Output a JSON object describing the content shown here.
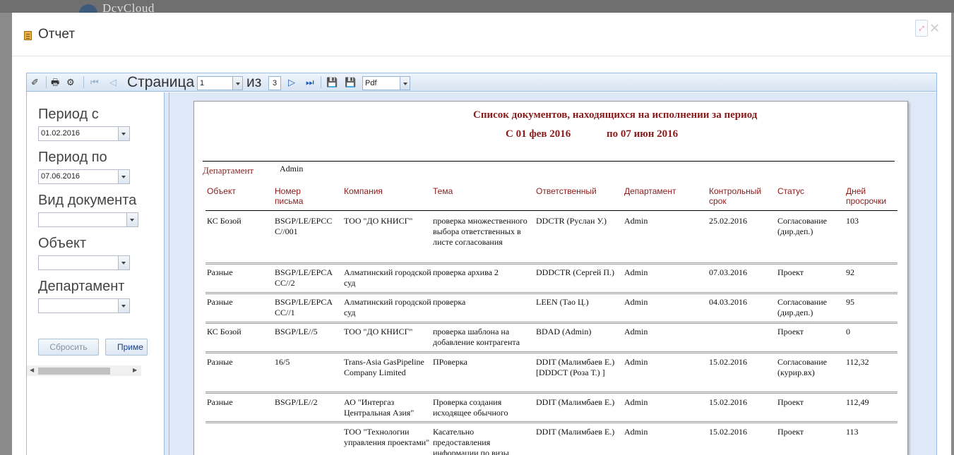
{
  "background": {
    "brand": "DcvCloud"
  },
  "modal": {
    "title": "Отчет"
  },
  "toolbar": {
    "page_label": "Страница",
    "page_value": "1",
    "of_label": "из",
    "total_pages": "3",
    "format_value": "Pdf"
  },
  "params": {
    "period_from_label": "Период с",
    "period_from_value": "01.02.2016",
    "period_to_label": "Период по",
    "period_to_value": "07.06.2016",
    "doc_type_label": "Вид документа",
    "doc_type_value": "",
    "object_label": "Объект",
    "object_value": "",
    "department_label": "Департамент",
    "department_value": "",
    "reset_label": "Сбросить",
    "apply_label": "Приме"
  },
  "report": {
    "title": "Список документов, находящихся на исполнении за период",
    "period_from": "С 01 фев 2016",
    "period_to": "по 07 июн 2016",
    "department_label": "Департамент",
    "department_value": "Admin",
    "headers": [
      "Объект",
      "Номер письма",
      "Компания",
      "Тема",
      "Ответственный",
      "Департамент",
      "Контрольный срок",
      "Статус",
      "Дней просрочки"
    ],
    "rows": [
      {
        "object": "КС Бозой",
        "number": "BSGP/LE/EPCC C//001",
        "company": "ТОО \"ДО КНИСГ\"",
        "subject": "проверка множественного выбора ответственных в листе согласования",
        "responsible": "DDCTR (Руслан У.)",
        "department": "Admin",
        "deadline": "25.02.2016",
        "status": "Согласование (дир.деп.)",
        "overdue": "103"
      },
      {
        "object": "Разные",
        "number": "BSGP/LE/EPCA CC//2",
        "company": "Алматинский городской суд",
        "subject": "проверка архива 2",
        "responsible": "DDDCTR (Сергей П.)",
        "department": "Admin",
        "deadline": "07.03.2016",
        "status": "Проект",
        "overdue": "92"
      },
      {
        "object": "Разные",
        "number": "BSGP/LE/EPCA CC//1",
        "company": "Алматинский городской суд",
        "subject": "проверка",
        "responsible": "LEEN (Тао Ц.)",
        "department": "Admin",
        "deadline": "04.03.2016",
        "status": "Согласование (дир.деп.)",
        "overdue": "95"
      },
      {
        "object": "КС Бозой",
        "number": "BSGP/LE//5",
        "company": "ТОО \"ДО КНИСГ\"",
        "subject": "проверка шаблона на добавление контрагента",
        "responsible": "BDAD (Admin)",
        "department": "Admin",
        "deadline": "",
        "status": "Проект",
        "overdue": "0"
      },
      {
        "object": "Разные",
        "number": "16/5",
        "company": "Trans-Asia GasPipeline Company Limited",
        "subject": "ПРоверка",
        "responsible": "DDIT (Малимбаев Е.) [DDDCT (Роза Т.) ]",
        "department": "Admin",
        "deadline": "15.02.2016",
        "status": "Согласование (курир.вх)",
        "overdue": "112,32"
      },
      {
        "object": "Разные",
        "number": "BSGP/LE//2",
        "company": "АО \"Интергаз Центральная Азия\"",
        "subject": "Проверка создания исходящее обычного",
        "responsible": "DDIT (Малимбаев Е.)",
        "department": "Admin",
        "deadline": "15.02.2016",
        "status": "Проект",
        "overdue": "112,49"
      },
      {
        "object": "",
        "number": "",
        "company": "ТОО \"Технологии управления проектами\"",
        "subject": "Касательно предоставления информации по визы",
        "responsible": "DDIT (Малимбаев Е.)",
        "department": "Admin",
        "deadline": "15.02.2016",
        "status": "Проект",
        "overdue": "113"
      }
    ]
  }
}
